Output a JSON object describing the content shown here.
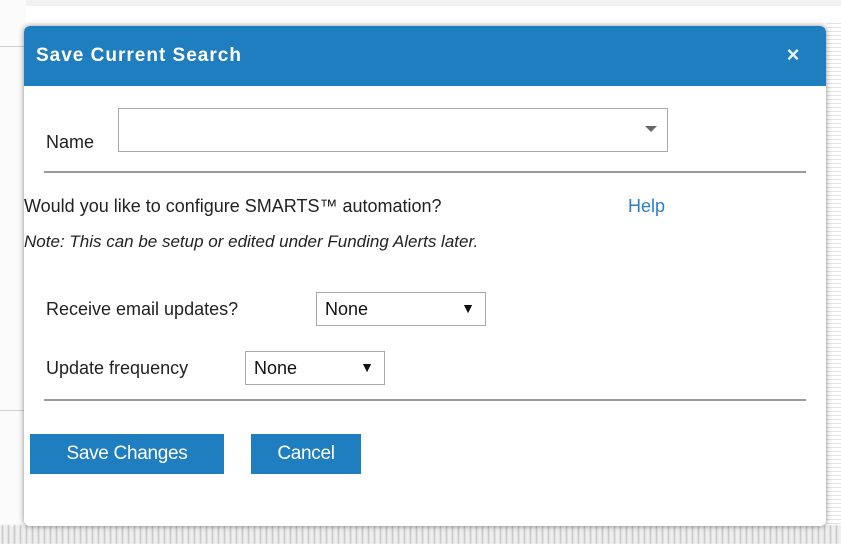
{
  "dialog": {
    "title": "Save Current Search",
    "close_symbol": "×",
    "name_label": "Name",
    "name_value": "",
    "question": "Would you like to configure SMARTS™ automation?",
    "help_link": "Help",
    "note": "Note: This can be setup or edited under Funding Alerts later.",
    "email_label": "Receive email updates?",
    "email_value": "None",
    "frequency_label": "Update frequency",
    "frequency_value": "None",
    "dropdown_arrow": "▼",
    "save_label": "Save Changes",
    "cancel_label": "Cancel"
  },
  "colors": {
    "accent": "#1f7ebf",
    "link": "#2a7fc2"
  },
  "icons": {
    "close": "close-icon",
    "dropdown": "chevron-down-icon"
  }
}
